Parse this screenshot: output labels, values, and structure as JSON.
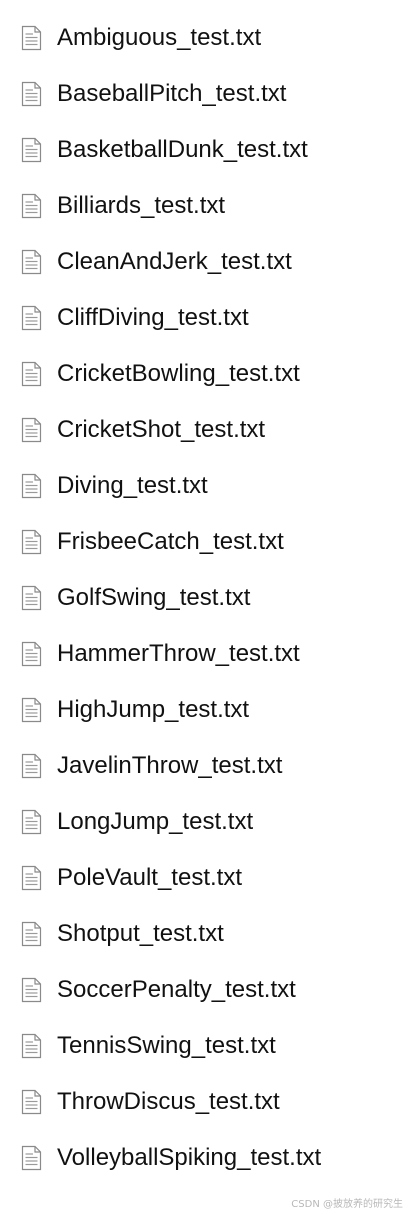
{
  "files": [
    {
      "name": "Ambiguous_test.txt",
      "icon": "text-file-icon"
    },
    {
      "name": "BaseballPitch_test.txt",
      "icon": "text-file-icon"
    },
    {
      "name": "BasketballDunk_test.txt",
      "icon": "text-file-icon"
    },
    {
      "name": "Billiards_test.txt",
      "icon": "text-file-icon"
    },
    {
      "name": "CleanAndJerk_test.txt",
      "icon": "text-file-icon"
    },
    {
      "name": "CliffDiving_test.txt",
      "icon": "text-file-icon"
    },
    {
      "name": "CricketBowling_test.txt",
      "icon": "text-file-icon"
    },
    {
      "name": "CricketShot_test.txt",
      "icon": "text-file-icon"
    },
    {
      "name": "Diving_test.txt",
      "icon": "text-file-icon"
    },
    {
      "name": "FrisbeeCatch_test.txt",
      "icon": "text-file-icon"
    },
    {
      "name": "GolfSwing_test.txt",
      "icon": "text-file-icon"
    },
    {
      "name": "HammerThrow_test.txt",
      "icon": "text-file-icon"
    },
    {
      "name": "HighJump_test.txt",
      "icon": "text-file-icon"
    },
    {
      "name": "JavelinThrow_test.txt",
      "icon": "text-file-icon"
    },
    {
      "name": "LongJump_test.txt",
      "icon": "text-file-icon"
    },
    {
      "name": "PoleVault_test.txt",
      "icon": "text-file-icon"
    },
    {
      "name": "Shotput_test.txt",
      "icon": "text-file-icon"
    },
    {
      "name": "SoccerPenalty_test.txt",
      "icon": "text-file-icon"
    },
    {
      "name": "TennisSwing_test.txt",
      "icon": "text-file-icon"
    },
    {
      "name": "ThrowDiscus_test.txt",
      "icon": "text-file-icon"
    },
    {
      "name": "VolleyballSpiking_test.txt",
      "icon": "text-file-icon"
    }
  ],
  "watermark": "CSDN @披放养的研究生",
  "colors": {
    "background": "#ffffff",
    "text": "#111111",
    "icon_stroke": "#8a8a8a"
  }
}
